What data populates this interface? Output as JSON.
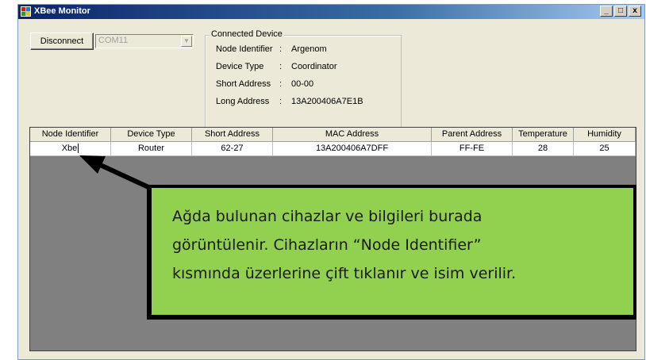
{
  "window": {
    "title": "XBee Monitor",
    "controls": {
      "minimize": "_",
      "maximize": "□",
      "close": "x"
    }
  },
  "toolbar": {
    "disconnect_label": "Disconnect",
    "port_value": "COM11"
  },
  "connected_device": {
    "legend": "Connected Device",
    "rows": [
      {
        "label": "Node Identifier",
        "value": "Argenom"
      },
      {
        "label": "Device Type",
        "value": "Coordinator"
      },
      {
        "label": "Short Address",
        "value": "00-00"
      },
      {
        "label": "Long Address",
        "value": "13A200406A7E1B"
      }
    ]
  },
  "grid": {
    "headers": [
      "Node Identifier",
      "Device Type",
      "Short Address",
      "MAC Address",
      "Parent Address",
      "Temperature",
      "Humidity"
    ],
    "rows": [
      [
        "Xbe",
        "Router",
        "62-27",
        "13A200406A7DFF",
        "FF-FE",
        "28",
        "25"
      ]
    ]
  },
  "callout": {
    "lines": [
      "Ağda bulunan cihazlar ve bilgileri burada",
      "görüntülenir. Cihazların “Node Identifier”",
      "kısmında üzerlerine çift tıklanır ve isim verilir."
    ]
  },
  "colors": {
    "callout_bg": "#92d050",
    "grid_bg": "#808080",
    "window_bg": "#ece9d8"
  }
}
